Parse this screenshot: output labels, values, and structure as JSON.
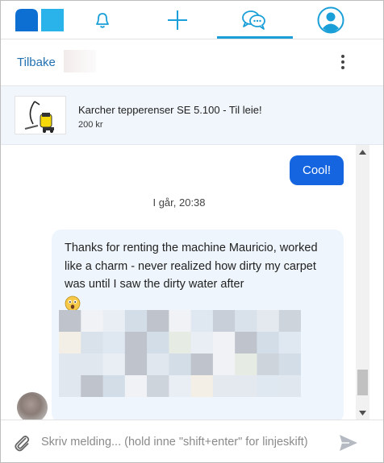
{
  "nav": {
    "logo_icon": "brand-logo",
    "items": [
      {
        "icon": "bell-icon"
      },
      {
        "icon": "plus-icon"
      },
      {
        "icon": "chat-bubbles-icon",
        "active": true
      },
      {
        "icon": "profile-icon"
      }
    ],
    "accent_color": "#1a9fd8"
  },
  "header": {
    "back_label": "Tilbake",
    "menu_icon": "kebab-menu-icon"
  },
  "product": {
    "title": "Karcher tepperenser SE 5.100 - Til leie!",
    "price": "200 kr"
  },
  "chat": {
    "outgoing": {
      "text": "Cool!",
      "color": "#1565e0"
    },
    "timestamp": "I går, 20:38",
    "incoming": {
      "text": "Thanks for renting the machine Mauricio, worked like a charm - never realized how dirty my carpet was until I saw the dirty water after",
      "emoji": "astonished-face-emoji",
      "attachment": "pixelated-image"
    }
  },
  "composer": {
    "placeholder": "Skriv melding... (hold inne \"shift+enter\" for linjeskift)",
    "attach_icon": "paperclip-icon",
    "send_icon": "send-icon"
  }
}
